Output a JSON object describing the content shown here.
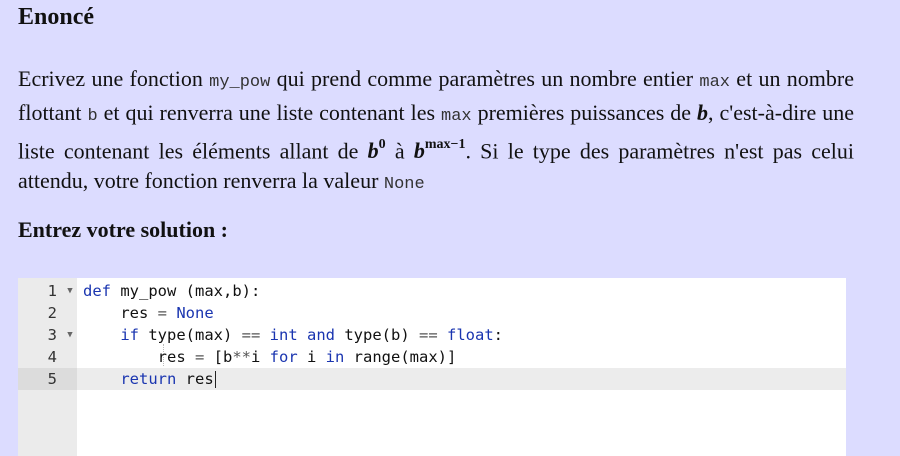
{
  "heading": "Enoncé",
  "statement": {
    "t1": "Ecrivez une fonction ",
    "c1": "my_pow",
    "t2": " qui prend comme paramètres un nombre entier ",
    "c2": "max",
    "t3": " et un nombre flottant ",
    "c3": "b",
    "t4": " et qui renverra une liste contenant les ",
    "c4": "max",
    "t5": " premières puissances de ",
    "m1": "b",
    "t6": ", c'est-à-dire une liste contenant les éléments allant de ",
    "m2_base": "b",
    "m2_exp": "0",
    "t7": " à ",
    "m3_base": "b",
    "m3_exp": "max−1",
    "t8": ". Si le type des paramètres n'est pas celui attendu, votre fonction renverra la valeur ",
    "c5": "None"
  },
  "solution_heading": "Entrez votre solution :",
  "editor": {
    "active_line": 5,
    "lines": [
      {
        "num": "1",
        "fold": "▼",
        "tokens": [
          {
            "k": "kw",
            "t": "def"
          },
          {
            "k": "",
            "t": " my_pow (max,b):"
          }
        ]
      },
      {
        "num": "2",
        "fold": "",
        "tokens": [
          {
            "k": "",
            "t": "    res "
          },
          {
            "k": "op",
            "t": "="
          },
          {
            "k": "kw",
            "t": " None"
          }
        ]
      },
      {
        "num": "3",
        "fold": "▼",
        "tokens": [
          {
            "k": "",
            "t": "    "
          },
          {
            "k": "kw",
            "t": "if"
          },
          {
            "k": "",
            "t": " type(max) "
          },
          {
            "k": "op",
            "t": "=="
          },
          {
            "k": "kw",
            "t": " int"
          },
          {
            "k": "",
            "t": " "
          },
          {
            "k": "kw",
            "t": "and"
          },
          {
            "k": "",
            "t": " type(b) "
          },
          {
            "k": "op",
            "t": "=="
          },
          {
            "k": "kw",
            "t": " float"
          },
          {
            "k": "",
            "t": ":"
          }
        ]
      },
      {
        "num": "4",
        "fold": "",
        "tokens": [
          {
            "k": "",
            "t": "        res "
          },
          {
            "k": "op",
            "t": "="
          },
          {
            "k": "",
            "t": " [b"
          },
          {
            "k": "op",
            "t": "**"
          },
          {
            "k": "",
            "t": "i "
          },
          {
            "k": "kw",
            "t": "for"
          },
          {
            "k": "",
            "t": " i "
          },
          {
            "k": "kw",
            "t": "in"
          },
          {
            "k": "",
            "t": " range(max)]"
          }
        ]
      },
      {
        "num": "5",
        "fold": "",
        "tokens": [
          {
            "k": "",
            "t": "    "
          },
          {
            "k": "kw",
            "t": "return"
          },
          {
            "k": "",
            "t": " res"
          }
        ]
      }
    ]
  }
}
